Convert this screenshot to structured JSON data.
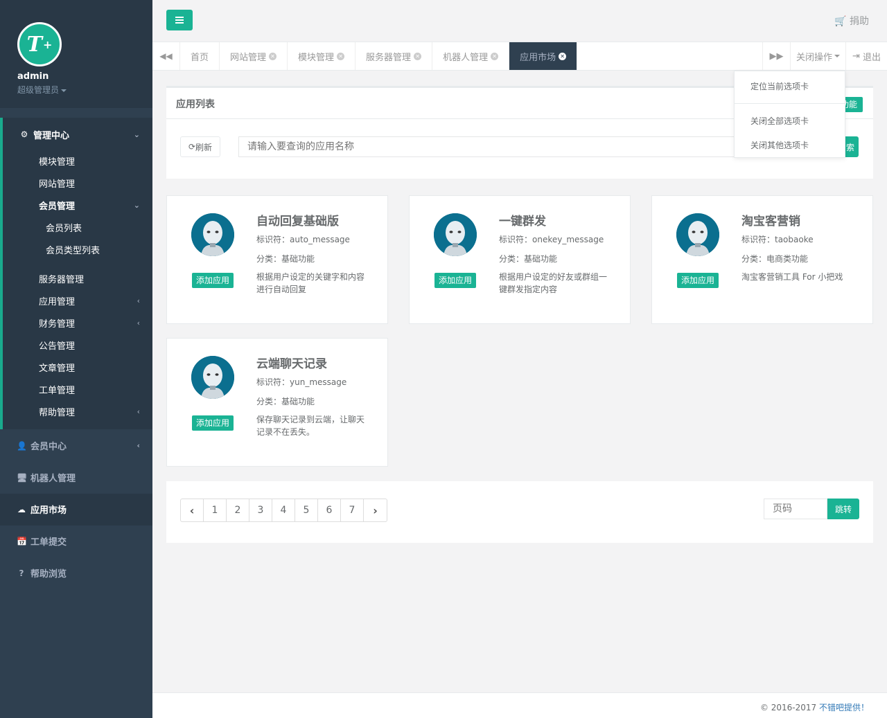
{
  "profile": {
    "logo_text": "T",
    "logo_sup": "+",
    "name": "admin",
    "role": "超级管理员"
  },
  "sidebar": {
    "manage_center": "管理中心",
    "items": [
      "模块管理",
      "网站管理",
      "会员管理",
      "会员列表",
      "会员类型列表",
      "服务器管理",
      "应用管理",
      "财务管理",
      "公告管理",
      "文章管理",
      "工单管理",
      "帮助管理"
    ],
    "bottom": [
      "会员中心",
      "机器人管理",
      "应用市场",
      "工单提交",
      "帮助浏览"
    ]
  },
  "header": {
    "donate": "捐助"
  },
  "tabs": {
    "items": [
      "首页",
      "网站管理",
      "模块管理",
      "服务器管理",
      "机器人管理",
      "应用市场"
    ],
    "close_ops": "关闭操作",
    "logout": "退出"
  },
  "dropdown": {
    "items": [
      "定位当前选项卡",
      "关闭全部选项卡",
      "关闭其他选项卡"
    ]
  },
  "panel": {
    "title": "应用列表",
    "add_fn": "功能",
    "refresh": "刷新",
    "search_placeholder": "请输入要查询的应用名称",
    "search_btn": "索"
  },
  "cards": [
    {
      "title": "自动回复基础版",
      "ident": "标识符：auto_message",
      "cat": "分类：基础功能",
      "desc": "根据用户设定的关键字和内容进行自动回复",
      "btn": "添加应用"
    },
    {
      "title": "一键群发",
      "ident": "标识符：onekey_message",
      "cat": "分类：基础功能",
      "desc": "根据用户设定的好友或群组一键群发指定内容",
      "btn": "添加应用"
    },
    {
      "title": "淘宝客营销",
      "ident": "标识符：taobaoke",
      "cat": "分类：电商类功能",
      "desc": "淘宝客营销工具 For 小把戏",
      "btn": "添加应用"
    },
    {
      "title": "云端聊天记录",
      "ident": "标识符：yun_message",
      "cat": "分类：基础功能",
      "desc": "保存聊天记录到云端，让聊天记录不在丢失。",
      "btn": "添加应用"
    }
  ],
  "pager": {
    "pages": [
      "1",
      "2",
      "3",
      "4",
      "5",
      "6",
      "7"
    ],
    "input_placeholder": "页码",
    "jump": "跳转"
  },
  "footer": {
    "copy": "© 2016-2017 ",
    "link": "不错吧提供！"
  },
  "colors": {
    "accent": "#1ab394",
    "sidebar": "#2f4050",
    "sidebar_dark": "#293846"
  }
}
